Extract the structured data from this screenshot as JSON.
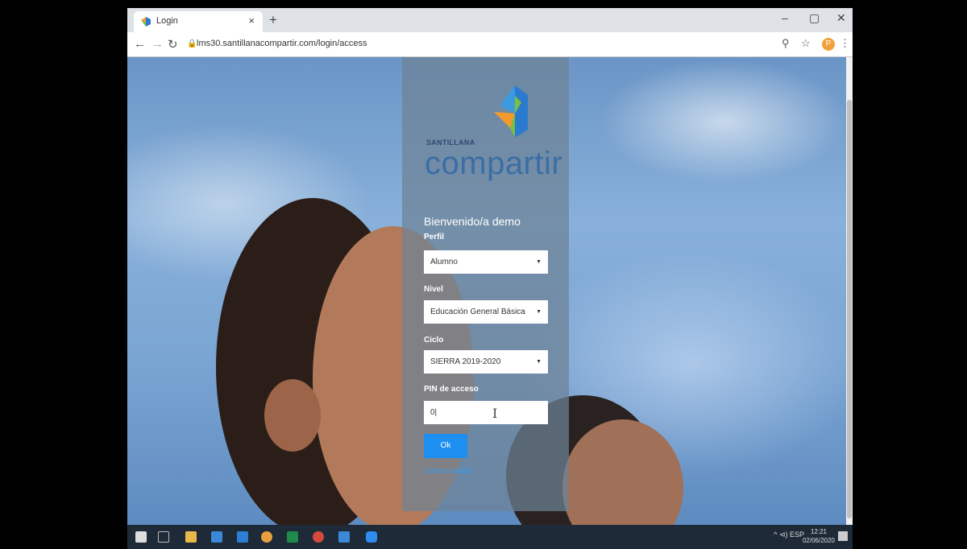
{
  "browser": {
    "tab_title": "Login",
    "new_tab": "+",
    "tab_close": "×",
    "url": "lms30.santillanacompartir.com/login/access",
    "profile_initial": "P",
    "window": {
      "minimize": "–",
      "maximize": "▢",
      "close": "✕"
    }
  },
  "login": {
    "brand_top": "SANTILLANA",
    "brand_main": "compartir",
    "welcome": "Bienvenido/a demo",
    "perfil_label": "Perfil",
    "perfil_value": "Alumno",
    "nivel_label": "Nivel",
    "nivel_value": "Educación General Básica",
    "ciclo_label": "Ciclo",
    "ciclo_value": "SIERRA 2019-2020",
    "pin_label": "PIN de acceso",
    "pin_value": "0|",
    "ok_label": "Ok",
    "logout_label": "Cerrar sesión"
  },
  "taskbar": {
    "tray": "^  ⊲)  ESP",
    "time": "12:21",
    "date": "02/06/2020"
  },
  "colors": {
    "accent": "#1d8ff0",
    "brand": "#3a6ea5",
    "panel": "#6e8296"
  }
}
